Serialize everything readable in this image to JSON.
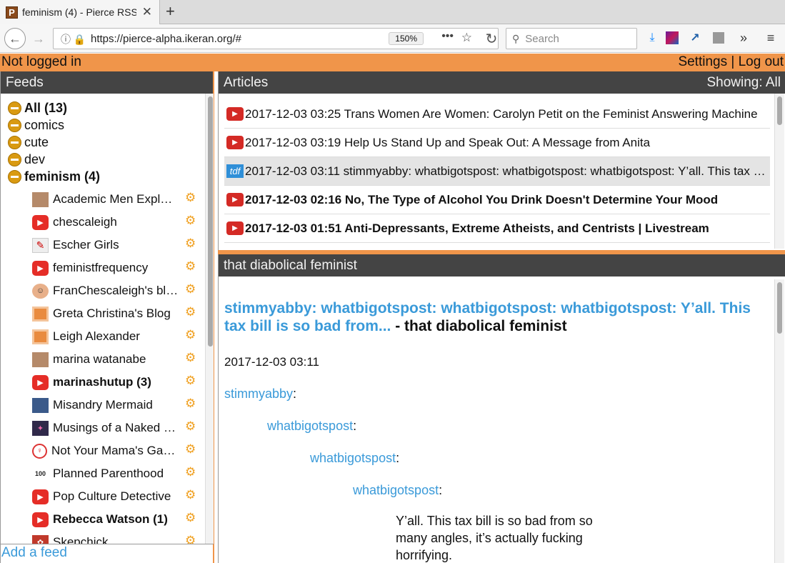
{
  "browser": {
    "tab_title": "feminism (4) - Pierce RSS",
    "favicon_letter": "P",
    "url": "https://pierce-alpha.ikeran.org/#",
    "zoom": "150%",
    "search_placeholder": "Search"
  },
  "topbar": {
    "status": "Not logged in",
    "settings": "Settings",
    "separator": "|",
    "logout": "Log out"
  },
  "feeds_panel": {
    "title": "Feeds",
    "categories": [
      {
        "label": "All (13)",
        "bold": true
      },
      {
        "label": "comics",
        "bold": false
      },
      {
        "label": "cute",
        "bold": false
      },
      {
        "label": "dev",
        "bold": false
      },
      {
        "label": "feminism (4)",
        "bold": true
      }
    ],
    "feeds": [
      {
        "name": "Academic Men Explain Things to Me",
        "icon": "photo-icon",
        "bold": false
      },
      {
        "name": "chescaleigh",
        "icon": "youtube-icon",
        "bold": false
      },
      {
        "name": "Escher Girls",
        "icon": "drawing-icon",
        "bold": false
      },
      {
        "name": "feministfrequency",
        "icon": "youtube-icon",
        "bold": false
      },
      {
        "name": "FranChescaleigh's blog",
        "icon": "avatar-icon",
        "bold": false
      },
      {
        "name": "Greta Christina's Blog",
        "icon": "rss-icon",
        "bold": false
      },
      {
        "name": "Leigh Alexander",
        "icon": "rss-icon",
        "bold": false
      },
      {
        "name": "marina watanabe",
        "icon": "photo-icon",
        "bold": false
      },
      {
        "name": "marinashutup (3)",
        "icon": "youtube-icon",
        "bold": true
      },
      {
        "name": "Misandry Mermaid",
        "icon": "map-icon",
        "bold": false
      },
      {
        "name": "Musings of a Naked Mind",
        "icon": "dark-icon",
        "bold": false
      },
      {
        "name": "Not Your Mama's Gamer",
        "icon": "ring-icon",
        "bold": false
      },
      {
        "name": "Planned Parenthood",
        "icon": "planned-parenthood-icon",
        "bold": false
      },
      {
        "name": "Pop Culture Detective",
        "icon": "youtube-icon",
        "bold": false
      },
      {
        "name": "Rebecca Watson (1)",
        "icon": "youtube-icon",
        "bold": true
      },
      {
        "name": "Skepchick",
        "icon": "red-icon",
        "bold": false
      }
    ],
    "add_feed": "Add a feed"
  },
  "articles_panel": {
    "title": "Articles",
    "filter": "Showing: All",
    "items": [
      {
        "text": "2017-12-03 03:25 Trans Women Are Women: Carolyn Petit on the Feminist Answering Machine",
        "icon": "youtube-icon",
        "bold": false,
        "selected": false
      },
      {
        "text": "2017-12-03 03:19 Help Us Stand Up and Speak Out: A Message from Anita",
        "icon": "youtube-icon",
        "bold": false,
        "selected": false
      },
      {
        "text": "2017-12-03 03:11 stimmyabby: whatbigotspost: whatbigotspost: whatbigotspost: Y’all. This tax bill is so bad from...",
        "icon": "tdf-icon",
        "bold": false,
        "selected": true
      },
      {
        "text": "2017-12-03 02:16 No, The Type of Alcohol You Drink Doesn't Determine Your Mood",
        "icon": "youtube-icon",
        "bold": true,
        "selected": false
      },
      {
        "text": "2017-12-03 01:51 Anti-Depressants, Extreme Atheists, and Centrists | Livestream",
        "icon": "youtube-icon",
        "bold": true,
        "selected": false
      }
    ]
  },
  "reader": {
    "feed_title": "that diabolical feminist",
    "article_link": "stimmyabby: whatbigotspost: whatbigotspost: whatbigotspost: Y’all. This tax bill is so bad from...",
    "title_suffix": " - that diabolical feminist",
    "date": "2017-12-03 03:11",
    "quote_chain": [
      "stimmyabby",
      "whatbigotspost",
      "whatbigotspost",
      "whatbigotspost"
    ],
    "colon": ":",
    "body": "Y’all. This tax bill is so bad from so many angles, it’s actually fucking horrifying."
  },
  "colors": {
    "accent": "#f0954a",
    "header": "#444444",
    "link": "#3a9ad9"
  }
}
